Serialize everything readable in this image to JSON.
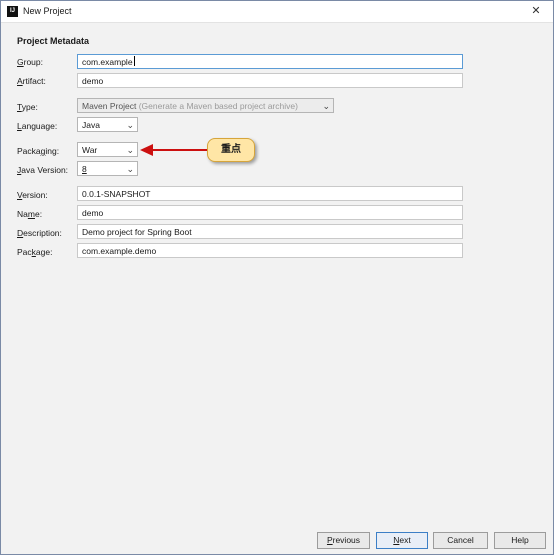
{
  "window": {
    "title": "New Project",
    "app_icon": "IJ"
  },
  "section_title": "Project Metadata",
  "fields": {
    "group": {
      "label_key": "G",
      "label_rest": "roup:",
      "value": "com.example"
    },
    "artifact": {
      "label_key": "A",
      "label_rest": "rtifact:",
      "value": "demo"
    },
    "type": {
      "label_key": "T",
      "label_rest": "ype:",
      "value": "Maven Project",
      "hint": "(Generate a Maven based project archive)"
    },
    "language": {
      "label_key": "L",
      "label_rest": "anguage:",
      "value": "Java"
    },
    "packaging": {
      "label_pre": "Packa",
      "label_key": "g",
      "label_rest": "ing:",
      "value": "War"
    },
    "java_version": {
      "label_key": "J",
      "label_rest": "ava Version:",
      "value": "8"
    },
    "version": {
      "label_key": "V",
      "label_rest": "ersion:",
      "value": "0.0.1-SNAPSHOT"
    },
    "name": {
      "label_pre": "Na",
      "label_key": "m",
      "label_rest": "e:",
      "value": "demo"
    },
    "description": {
      "label_key": "D",
      "label_rest": "escription:",
      "value": "Demo project for Spring Boot"
    },
    "package": {
      "label_pre": "Pac",
      "label_key": "k",
      "label_rest": "age:",
      "value": "com.example.demo"
    }
  },
  "callout": {
    "text": "重点"
  },
  "buttons": {
    "previous": {
      "key": "P",
      "rest": "revious"
    },
    "next": {
      "key": "N",
      "rest": "ext"
    },
    "cancel": "Cancel",
    "help": "Help"
  },
  "icons": {
    "close": "close-icon",
    "chevron": "chevron-down-icon",
    "arrow": "red-arrow"
  },
  "colors": {
    "arrow": "#cc1010",
    "callout_bg": "#ffe6a6",
    "focus": "#5b9bd5"
  }
}
